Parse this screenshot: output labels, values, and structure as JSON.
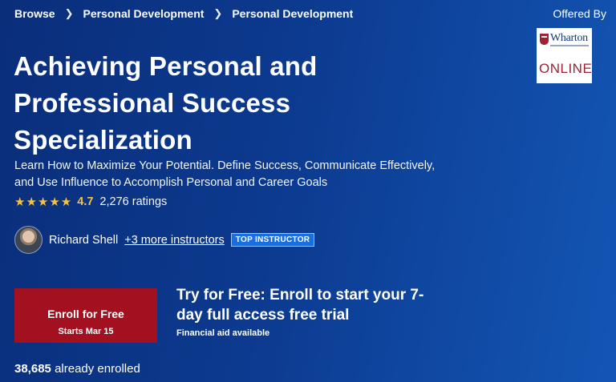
{
  "breadcrumb": [
    "Browse",
    "Personal Development",
    "Personal Development"
  ],
  "offered_by": "Offered By",
  "partner": {
    "name": "Wharton",
    "label": "ONLINE",
    "brand_color": "#9d2235"
  },
  "course": {
    "title_lines": [
      "Achieving Personal and",
      "Professional Success",
      "Specialization"
    ],
    "description_lines": [
      "Learn How to Maximize Your Potential. Define Success, Communicate Effectively,",
      "and Use Influence to Accomplish Personal and Career Goals"
    ],
    "rating": {
      "stars": "★★★★★",
      "value": "4.7",
      "count": "2,276 ratings"
    },
    "instructor": {
      "name": "Richard Shell",
      "more": "+3 more instructors",
      "badge": "TOP INSTRUCTOR"
    }
  },
  "enroll": {
    "label": "Enroll for Free",
    "starts": "Starts Mar 15",
    "color": "#a3101f"
  },
  "trial": {
    "lines": [
      "Try for Free: Enroll to start your 7-",
      "day full access free trial"
    ],
    "aid": "Financial aid available"
  },
  "enrolled": {
    "count": "38,685",
    "text": "already enrolled"
  }
}
